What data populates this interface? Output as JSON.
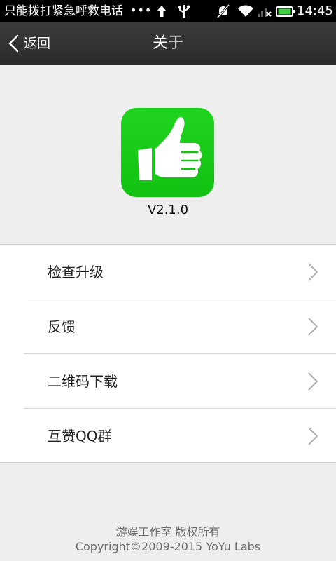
{
  "status_bar": {
    "carrier_text": "只能拨打紧急呼救电话",
    "dots": "•••",
    "time": "14:45",
    "icons": [
      "upload-arrow-icon",
      "usb-icon",
      "muted-notification-icon",
      "wifi-icon",
      "signal-icon",
      "battery-icon"
    ]
  },
  "header": {
    "back_label": "返回",
    "title": "关于"
  },
  "app": {
    "logo_icon": "thumbs-up-icon",
    "logo_color": "#1ac81a",
    "version": "V2.1.0"
  },
  "menu": {
    "items": [
      {
        "label": "检查升级"
      },
      {
        "label": "反馈"
      },
      {
        "label": "二维码下载"
      },
      {
        "label": "互赞QQ群"
      }
    ]
  },
  "footer": {
    "studio": "游娱工作室  版权所有",
    "copyright": "Copyright©2009-2015 YoYu Labs"
  }
}
